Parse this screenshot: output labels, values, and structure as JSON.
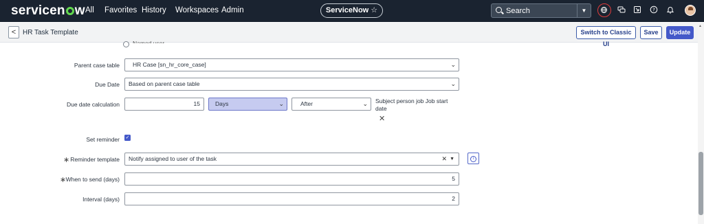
{
  "topnav": {
    "logo": "servicenow",
    "menu": [
      "All",
      "Favorites",
      "History",
      "Workspaces",
      "Admin"
    ],
    "app_pill": "ServiceNow ☆",
    "search_placeholder": "Search"
  },
  "subbar": {
    "back": "<",
    "title": "HR Task Template",
    "buttons": {
      "switch_classic": "Switch to Classic UI",
      "save": "Save",
      "update": "Update"
    }
  },
  "form": {
    "radio_label": "Named user",
    "parent_case_table": {
      "label": "Parent case table",
      "value": "HR Case [sn_hr_core_case]"
    },
    "due_date": {
      "label": "Due Date",
      "value": "Based on parent case table"
    },
    "due_date_calc": {
      "label": "Due date calculation",
      "amount": "15",
      "unit": "Days",
      "relation": "After",
      "note": "Subject person job Job start date"
    },
    "set_reminder": {
      "label": "Set reminder",
      "checked": true
    },
    "reminder_template": {
      "label": "Reminder template",
      "value": "Notify assigned to user of the task",
      "required": true
    },
    "when_to_send": {
      "label": "When to send (days)",
      "value": "5",
      "required": true
    },
    "interval": {
      "label": "Interval (days)",
      "value": "2"
    }
  },
  "colors": {
    "nav_bg": "#1a2330",
    "accent": "#4459c9",
    "logo_green": "#62d84e",
    "highlight_ring": "#e03b3b"
  }
}
